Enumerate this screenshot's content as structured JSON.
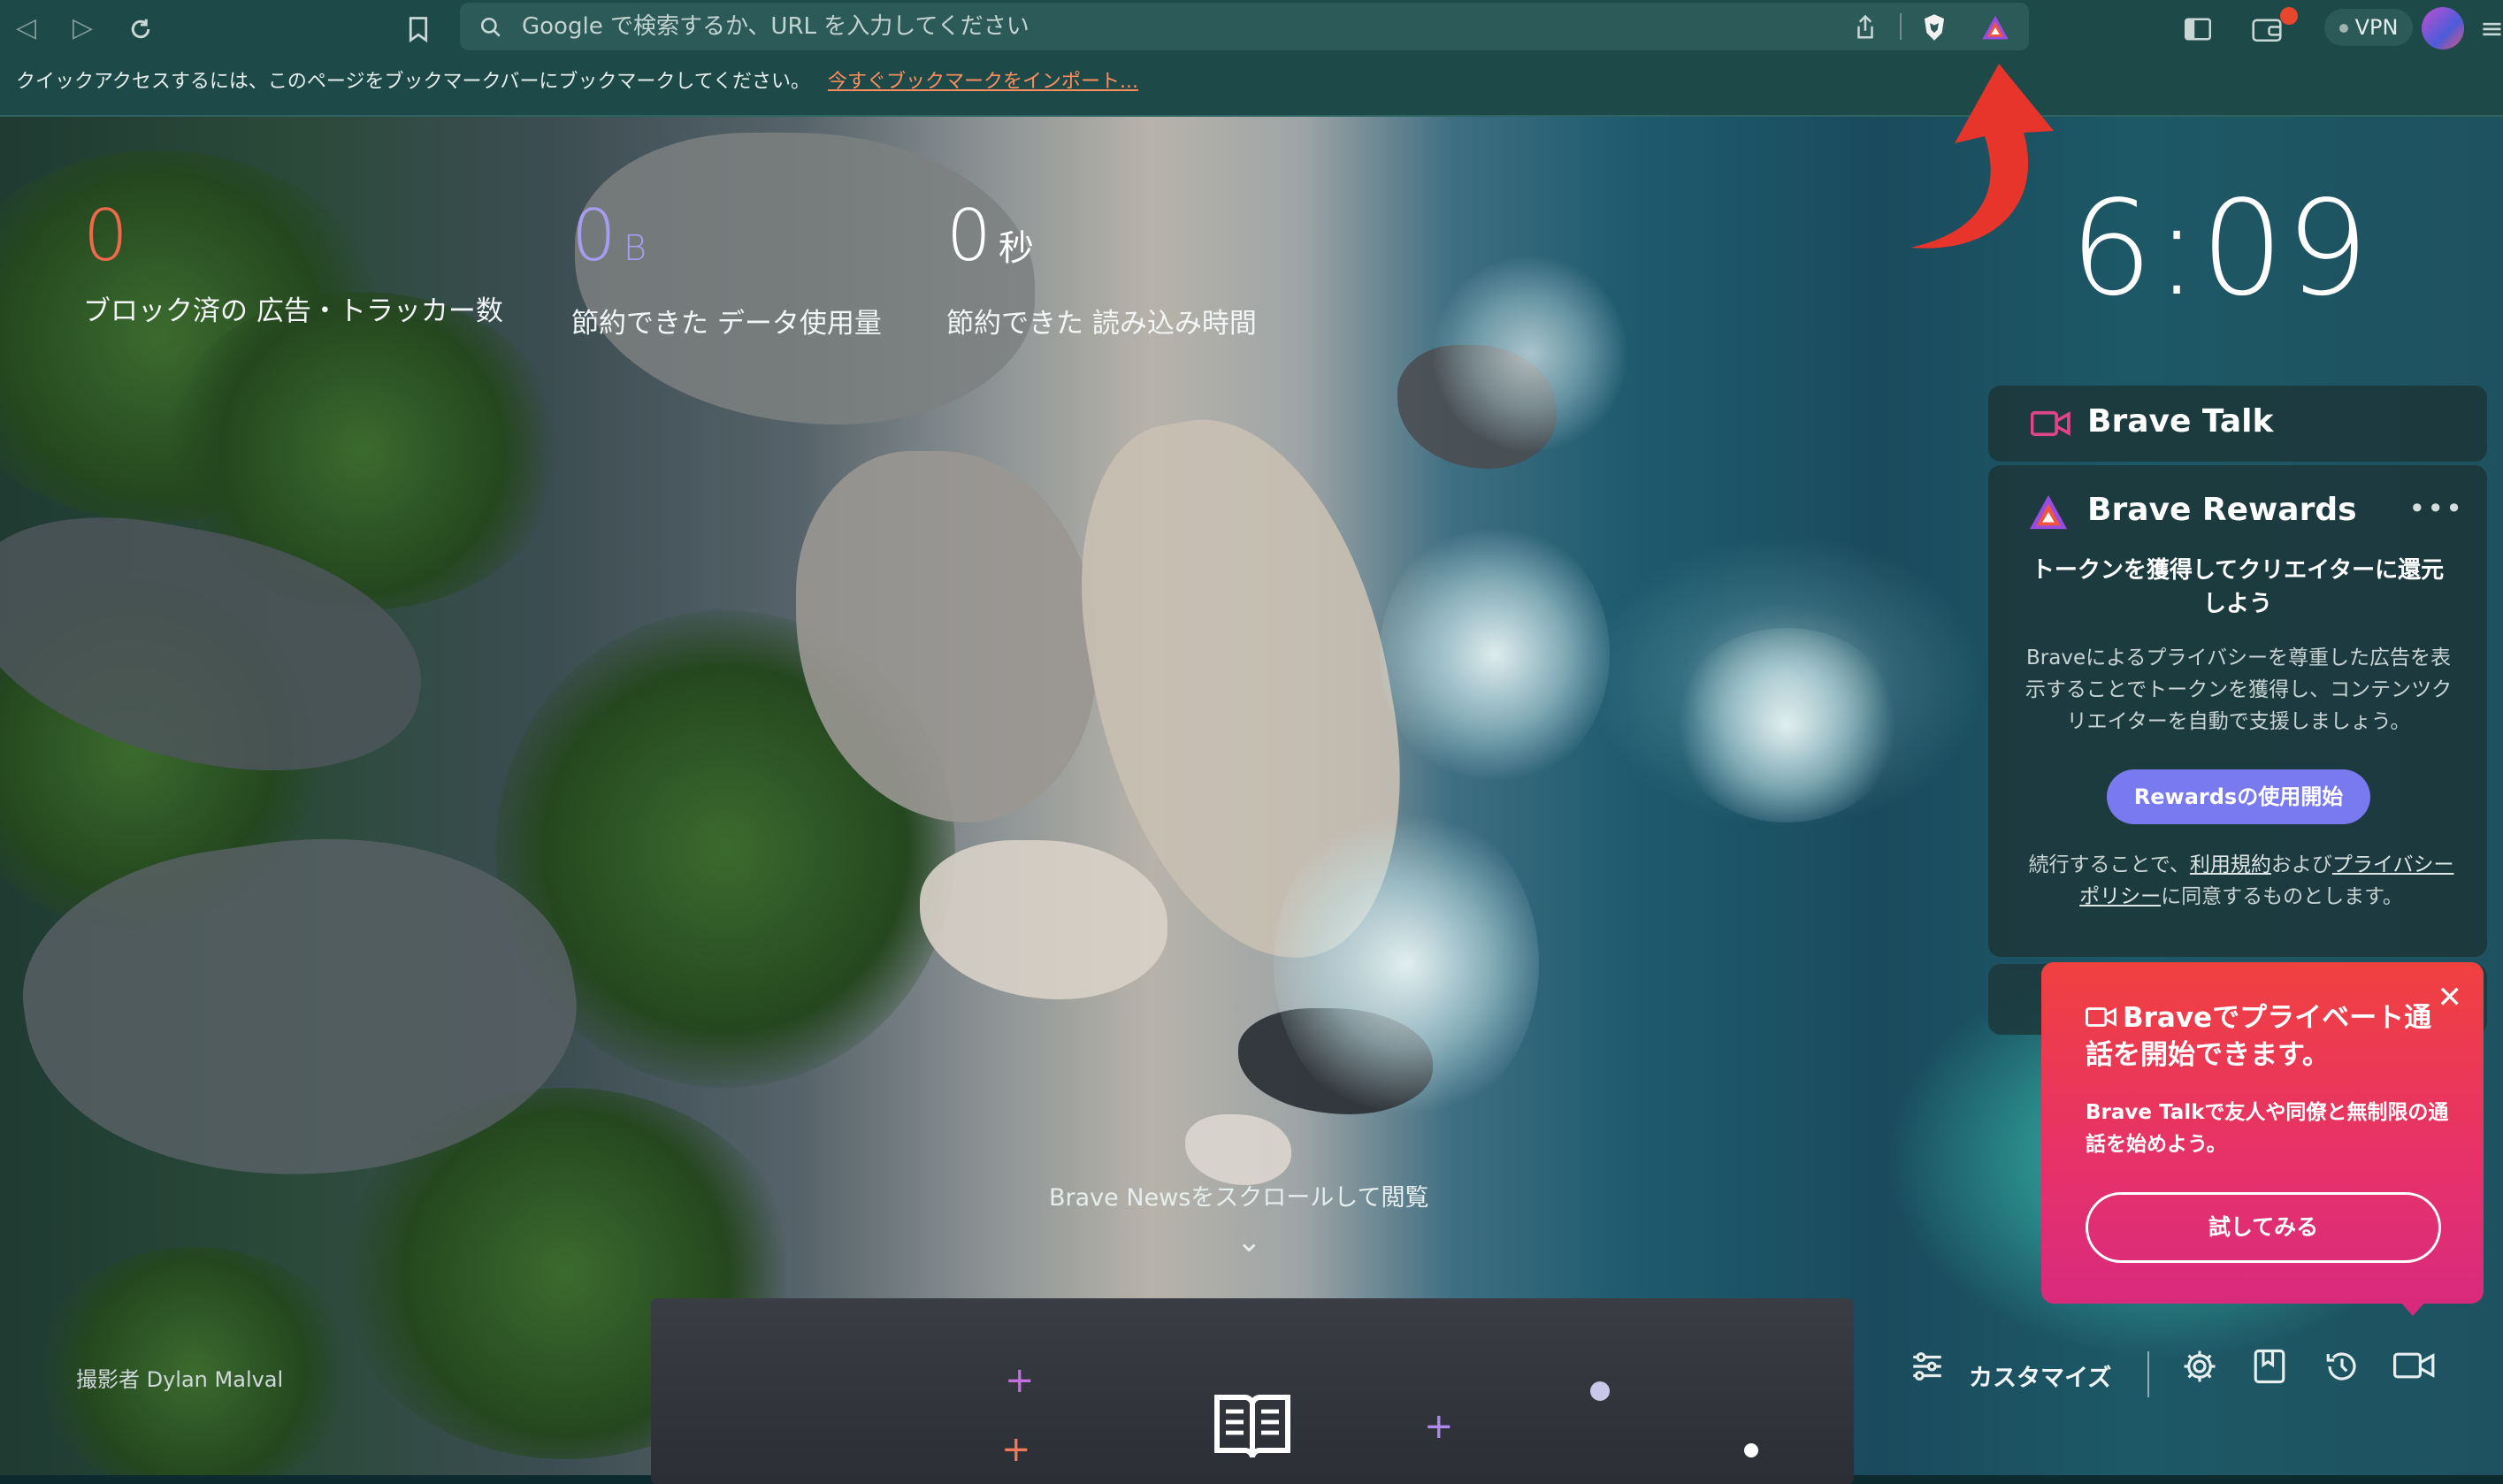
{
  "toolbar": {
    "search_placeholder": "Google で検索するか、URL を入力してください",
    "vpn_label": "VPN"
  },
  "bookmark_bar": {
    "message": "クイックアクセスするには、このページをブックマークバーにブックマークしてください。",
    "import_link": "今すぐブックマークをインポート..."
  },
  "stats": [
    {
      "value": "0",
      "unit": "",
      "label": "ブロック済の 広告・トラッカー数",
      "color": "#ef6a4a"
    },
    {
      "value": "0",
      "unit": "B",
      "label": "節約できた データ使用量",
      "color": "#a79cf0"
    },
    {
      "value": "0",
      "unit": "秒",
      "label": "節約できた 読み込み時間",
      "color": "#ffffff"
    }
  ],
  "clock": "6:09",
  "brave_talk_card": {
    "title": "Brave Talk"
  },
  "rewards_card": {
    "title": "Brave Rewards",
    "heading": "トークンを獲得してクリエイターに還元しよう",
    "body": "Braveによるプライバシーを尊重した広告を表示することでトークンを獲得し、コンテンツクリエイターを自動で支援しましょう。",
    "button": "Rewardsの使用開始",
    "legal_prefix": "続行することで、",
    "terms_link": "利用規約",
    "legal_and": "および",
    "privacy_link": "プライバシーポリシー",
    "legal_suffix": "に同意するものとします。"
  },
  "talk_popup": {
    "title": "Braveでプライベート通話を開始できます。",
    "body": "Brave Talkで友人や同僚と無制限の通話を始めよう。",
    "button": "試してみる"
  },
  "news_hint": "Brave Newsをスクロールして閲覧",
  "photo_credit": "撮影者 Dylan Malval",
  "customize_label": "カスタマイズ",
  "colors": {
    "toolbar_bg": "#1d4a48",
    "accent_rewards": "#7a7af0",
    "popup_gradient_start": "#f0413f",
    "popup_gradient_end": "#d92b7e",
    "arrow_red": "#e8352b"
  },
  "icons": [
    "back-icon",
    "forward-icon",
    "reload-icon",
    "bookmark-icon",
    "search-icon",
    "share-icon",
    "brave-shields-icon",
    "brave-rewards-icon",
    "sidebar-icon",
    "wallet-icon",
    "menu-icon",
    "video-camera-icon",
    "settings-icon",
    "bookmarks-icon",
    "history-icon",
    "news-book-icon",
    "close-icon",
    "chevron-down-icon",
    "customize-sliders-icon"
  ]
}
